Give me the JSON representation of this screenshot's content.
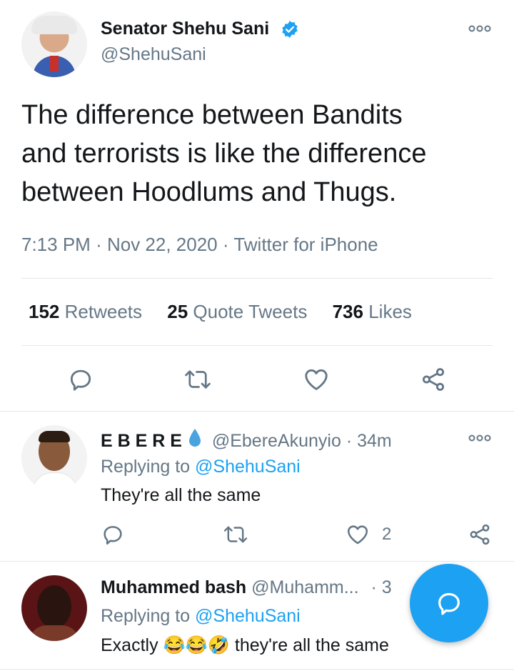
{
  "tweet": {
    "author_name": "Senator Shehu Sani",
    "handle": "@ShehuSani",
    "text_lines": [
      "The difference between Bandits",
      "and terrorists is like the difference",
      "between Hoodlums and Thugs."
    ],
    "time": "7:13 PM",
    "date": "Nov 22, 2020",
    "source": "Twitter for iPhone",
    "separator": "·",
    "stats": {
      "retweets_count": "152",
      "retweets_label": "Retweets",
      "quotes_count": "25",
      "quotes_label": "Quote Tweets",
      "likes_count": "736",
      "likes_label": "Likes"
    }
  },
  "replies": [
    {
      "author_name": "E B E R E",
      "handle": "@EbereAkunyio",
      "time": "· 34m",
      "replying_prefix": "Replying to",
      "replying_handle": "@ShehuSani",
      "text": "They're all the same",
      "like_count": "2"
    },
    {
      "author_name": "Muhammed bash",
      "handle": "@Muhamm...",
      "time": "· 3",
      "replying_prefix": "Replying to",
      "replying_handle": "@ShehuSani",
      "text_prefix": "Exactly",
      "emoji": "😂😂🤣",
      "text_suffix": "they're all the same"
    }
  ],
  "colors": {
    "accent": "#1da1f2",
    "muted": "#657786",
    "verified": "#1da1f2",
    "divider": "#e1e8ed"
  },
  "icons": [
    "verified-badge-icon",
    "more-icon",
    "reply-icon",
    "retweet-icon",
    "like-icon",
    "share-icon",
    "water-drop-icon",
    "compose-icon"
  ]
}
